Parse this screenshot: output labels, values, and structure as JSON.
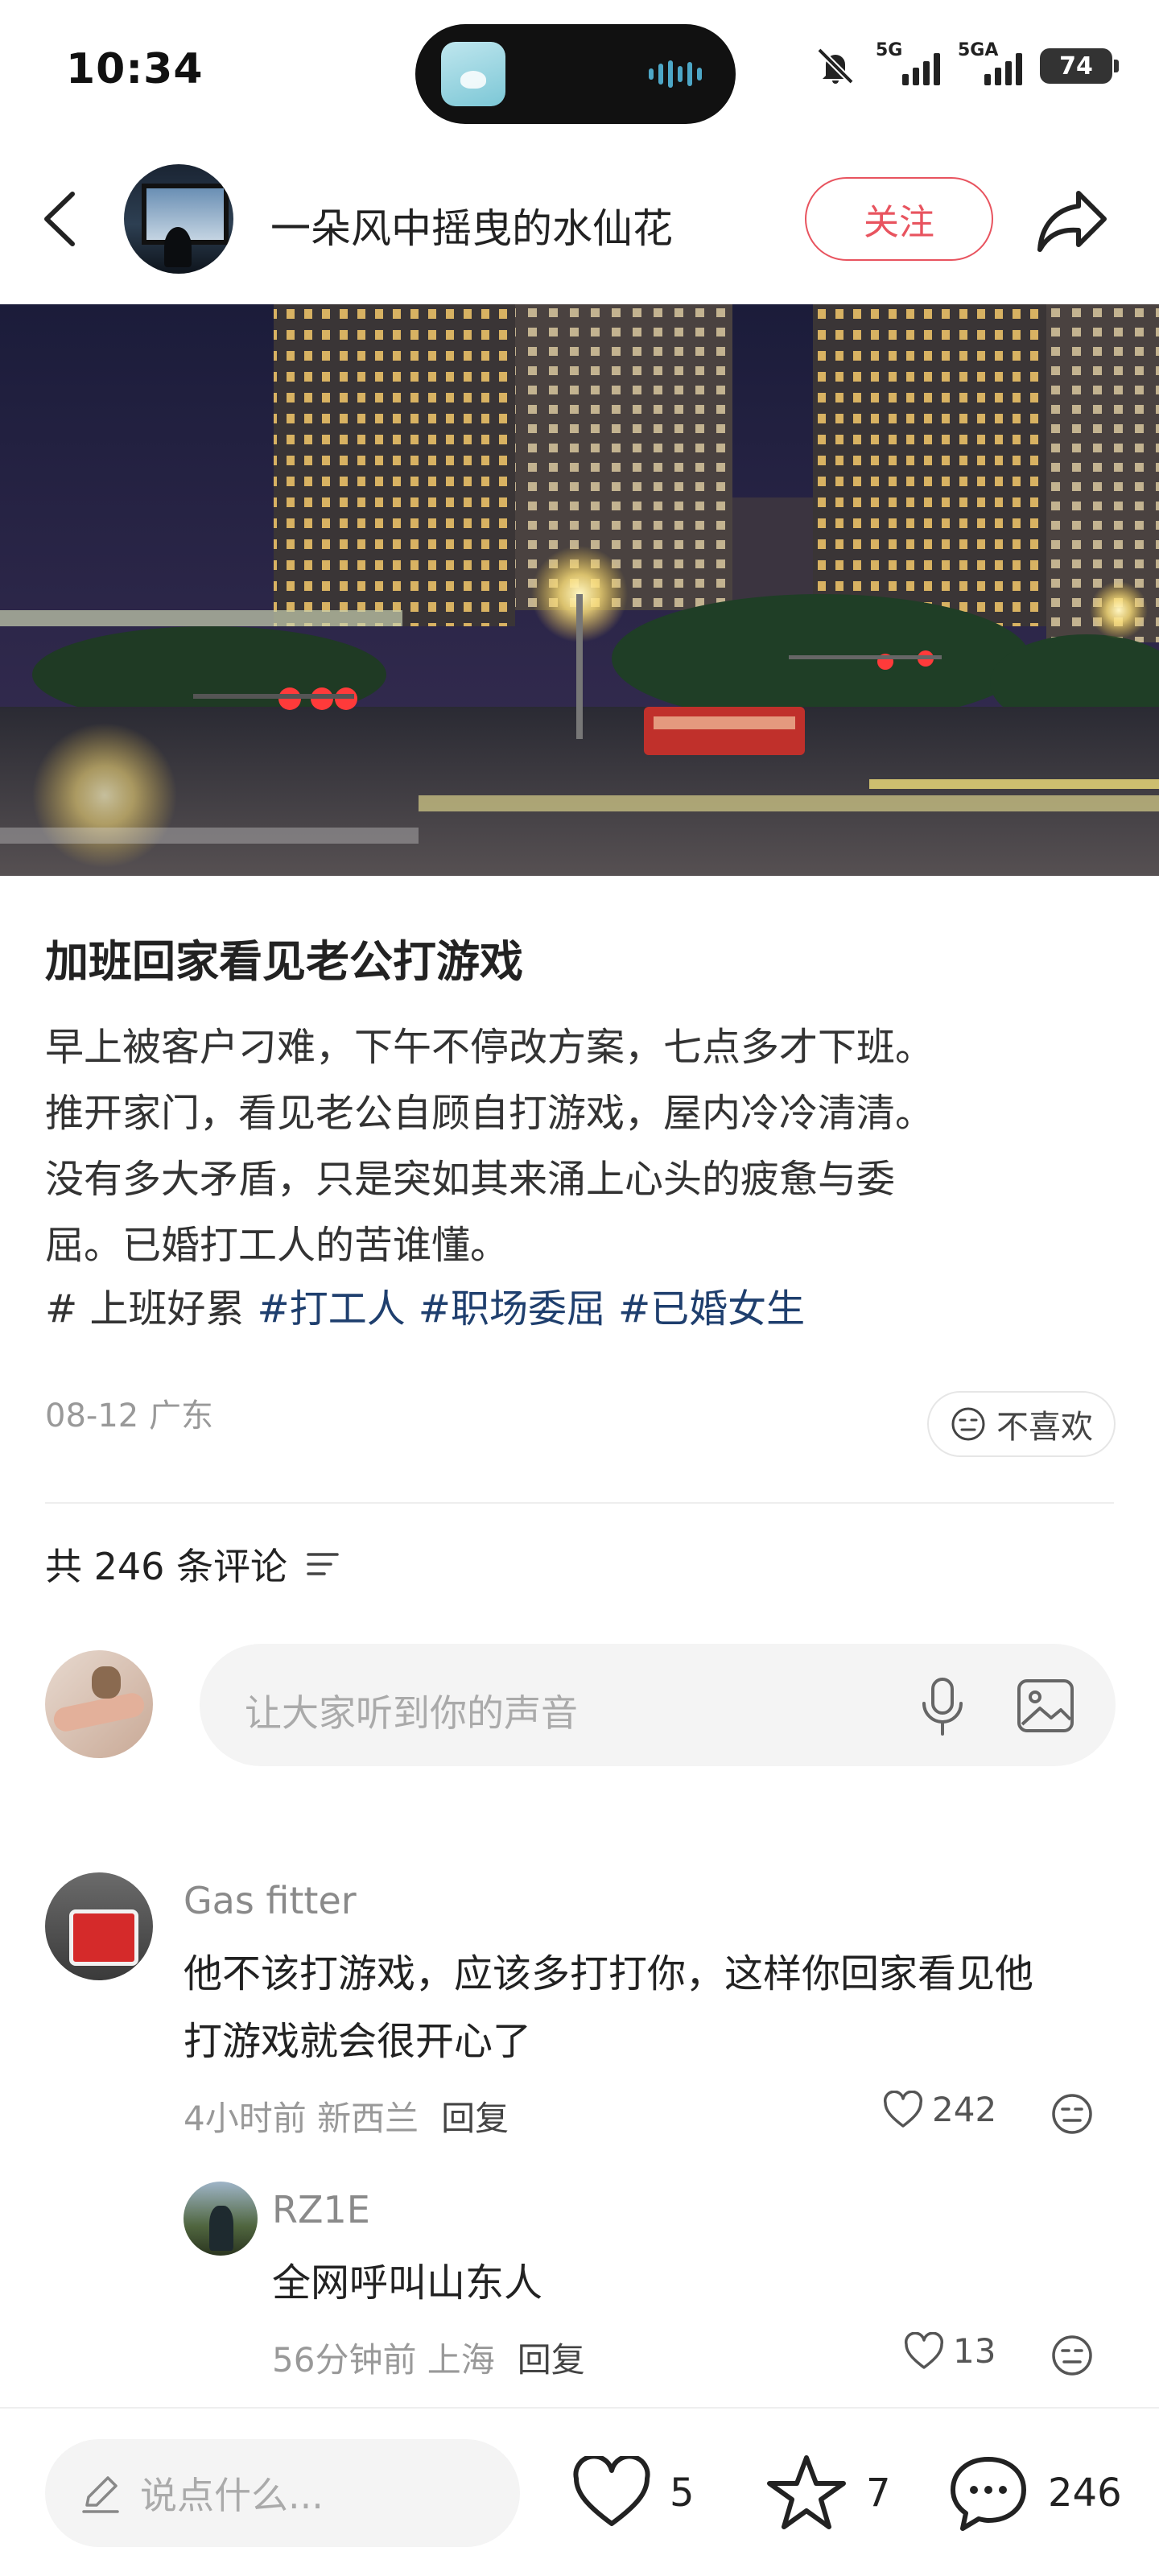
{
  "status_bar": {
    "time": "10:34",
    "signal_1_label": "5G",
    "signal_2_label": "5GA",
    "battery": "74",
    "icons": [
      "mute-icon",
      "signal-icon",
      "battery-icon"
    ]
  },
  "header": {
    "author_name": "一朵风中摇曳的水仙花",
    "follow_label": "关注",
    "accent_color": "#e8545f"
  },
  "post": {
    "title": "加班回家看见老公打游戏",
    "content_lines": [
      "早上被客户刁难，下午不停改方案，七点多才下班。",
      "推开家门，看见老公自顾自打游戏，屋内冷冷清清。",
      "没有多大矛盾，只是突如其来涌上心头的疲惫与委",
      "屈。已婚打工人的苦谁懂。"
    ],
    "tag_first": "# 上班好累",
    "tags": [
      "#打工人",
      "#职场委屈",
      "#已婚女生"
    ],
    "tag_color": "#1f3f6e",
    "meta": "08-12 广东",
    "dislike_label": "不喜欢"
  },
  "comments_section": {
    "count_label": "共 246 条评论",
    "input_placeholder": "让大家听到你的声音",
    "comments": [
      {
        "user": "Gas fitter",
        "text_lines": [
          "他不该打游戏，应该多打打你，这样你回家看见他",
          "打游戏就会很开心了"
        ],
        "meta": "4小时前 新西兰",
        "reply_label": "回复",
        "likes": "242"
      },
      {
        "user": "RZ1E",
        "text_lines": [
          "全网呼叫山东人"
        ],
        "meta": "56分钟前 上海",
        "reply_label": "回复",
        "likes": "13"
      }
    ]
  },
  "bottom_bar": {
    "say_placeholder": "说点什么...",
    "likes": "5",
    "favorites": "7",
    "comments": "246"
  }
}
